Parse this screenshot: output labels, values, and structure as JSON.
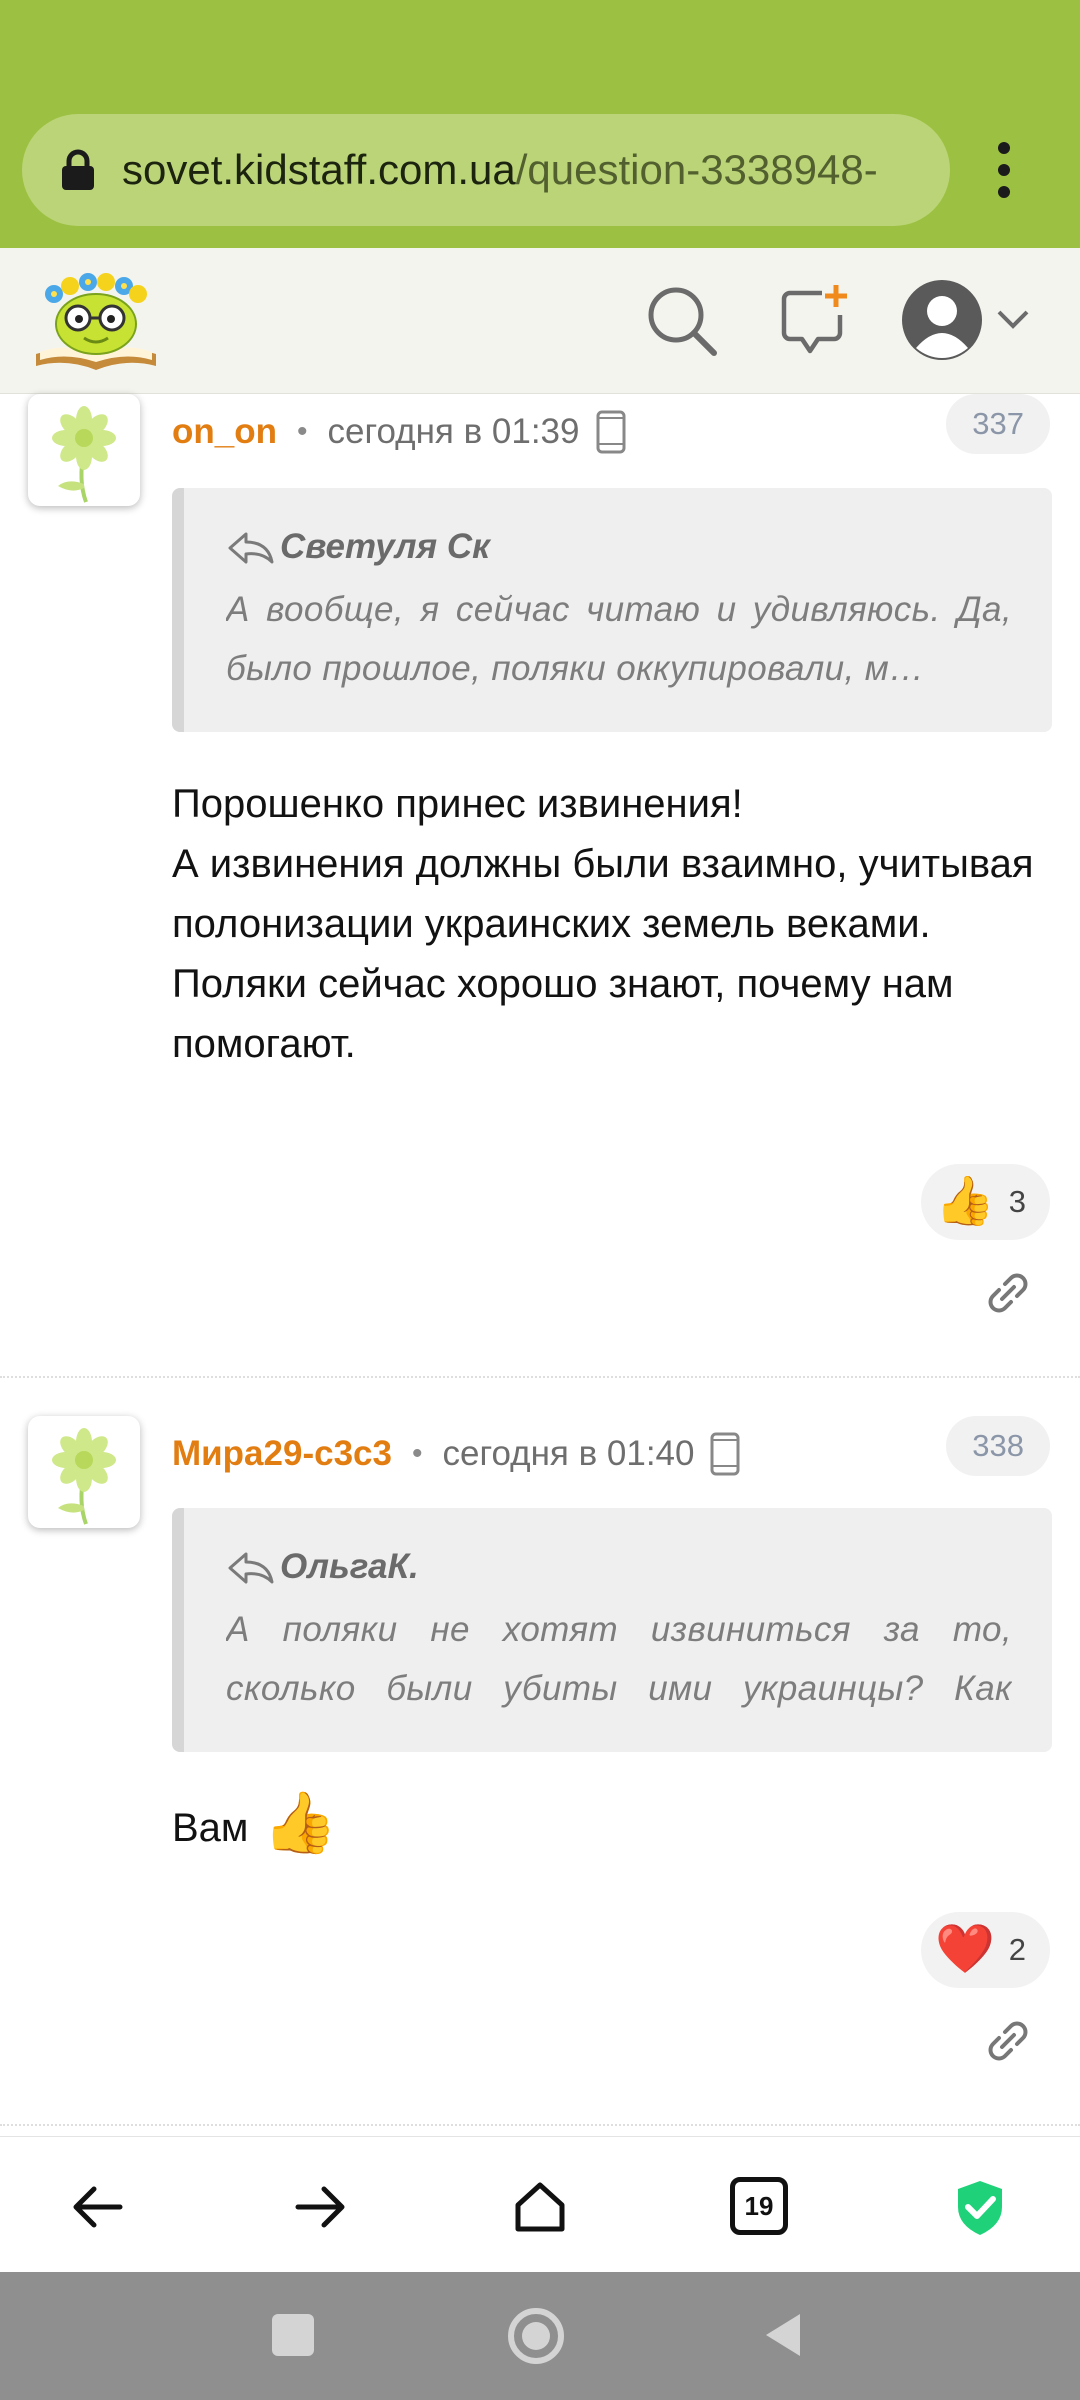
{
  "browser": {
    "url_host": "sovet.kidstaff.com.ua",
    "url_path": "/question-3338948-",
    "tab_count": "19"
  },
  "comments": [
    {
      "author": "on_on",
      "time": "сегодня в 01:39",
      "number": "337",
      "quote_author": "Светуля Ск",
      "quote_text": "А вообще, я сейчас читаю и удивляюсь. Да, было прошлое, поляки оккупировали, м…",
      "body_lines": [
        "Порошенко принес извинения!",
        "А извинения должны были взаимно, учитывая полонизации украинских земель веками.",
        "Поляки сейчас хорошо знают, почему нам помогают."
      ],
      "reaction_emoji": "👍",
      "reaction_count": "3"
    },
    {
      "author": "Мира29-с3с3",
      "time": "сегодня в 01:40",
      "number": "338",
      "quote_author": "ОльгаК.",
      "quote_text": "А поляки не хотят извиниться за то, сколько были убиты ими украинцы? Как запреща…",
      "body_text": "Вам",
      "body_emoji": "👍",
      "reaction_emoji": "❤️",
      "reaction_count": "2"
    }
  ],
  "colors": {
    "browser_bar": "#9cc142",
    "author": "#e27d12",
    "secure_shield": "#1fd27a"
  },
  "icons": {
    "lock": "lock-icon",
    "menu": "kebab-menu-icon",
    "search": "search-icon",
    "new_topic": "new-message-icon",
    "user": "user-avatar-icon",
    "reply": "reply-arrow-icon",
    "device": "phone-icon",
    "link": "link-icon"
  }
}
